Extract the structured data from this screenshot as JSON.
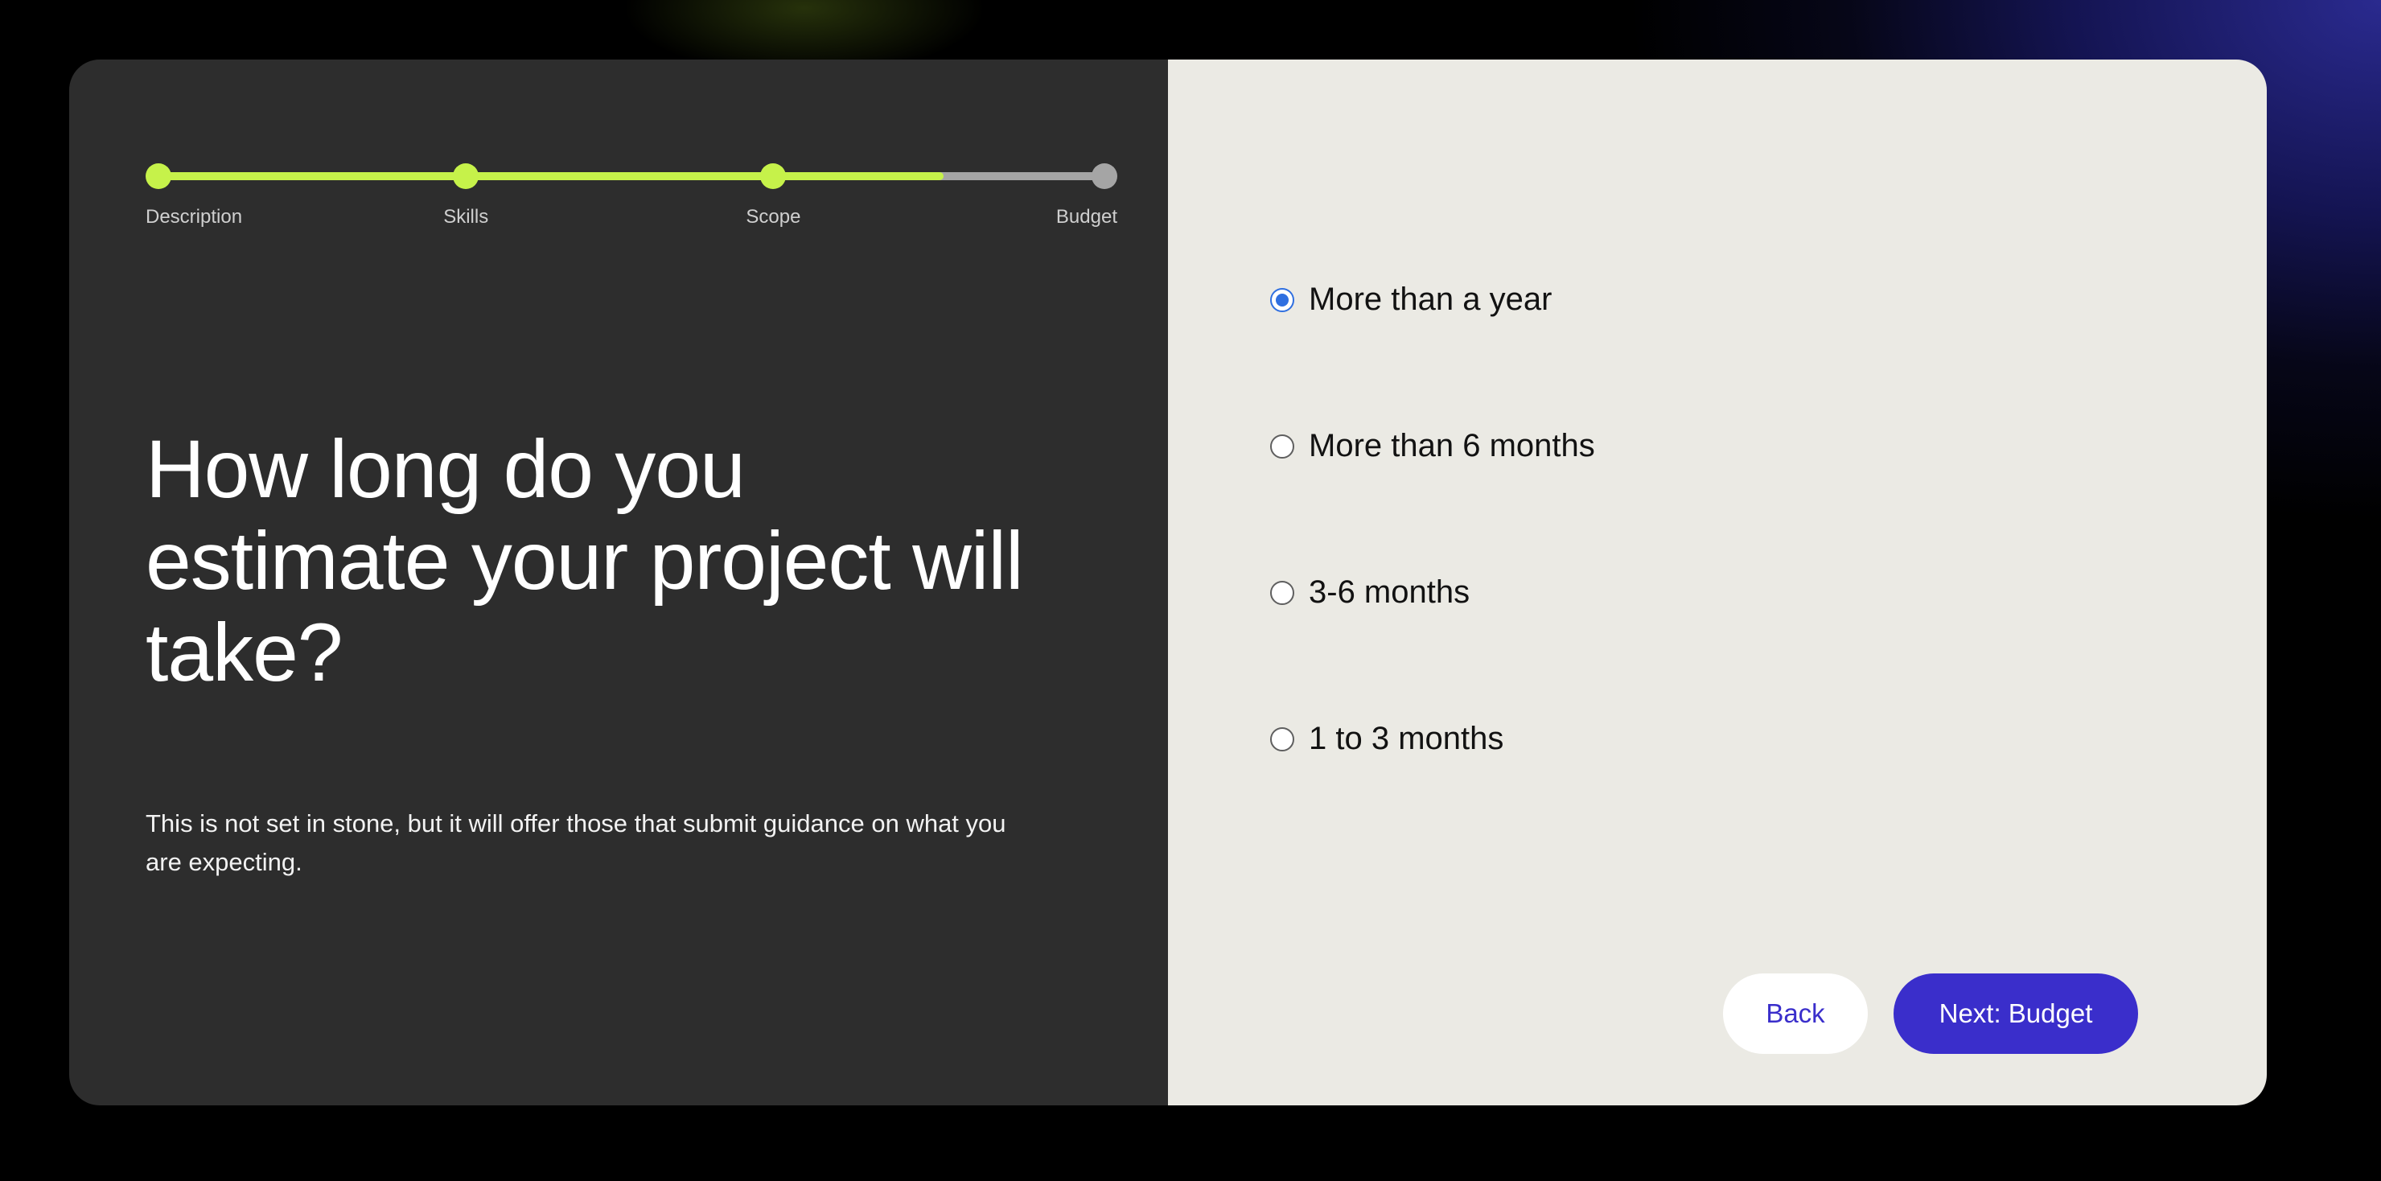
{
  "stepper": {
    "progress_fraction": 0.83,
    "steps": [
      {
        "label": "Description",
        "status": "complete",
        "position": 0
      },
      {
        "label": "Skills",
        "status": "complete",
        "position": 0.325
      },
      {
        "label": "Scope",
        "status": "complete",
        "position": 0.65
      },
      {
        "label": "Budget",
        "status": "pending",
        "position": 1
      }
    ]
  },
  "question": {
    "title": "How long do you estimate your project will take?",
    "helper": "This is not set in stone, but it will offer those that submit guidance on what you are expecting."
  },
  "options": [
    {
      "label": "More than a year",
      "selected": true
    },
    {
      "label": "More than 6 months",
      "selected": false
    },
    {
      "label": "3-6 months",
      "selected": false
    },
    {
      "label": "1 to 3 months",
      "selected": false
    }
  ],
  "actions": {
    "back_label": "Back",
    "next_label": "Next: Budget"
  },
  "colors": {
    "accent": "#3a2ecb",
    "progress": "#c6f24a",
    "pending": "#a5a5a5",
    "radio_selected": "#2f6fe0"
  }
}
